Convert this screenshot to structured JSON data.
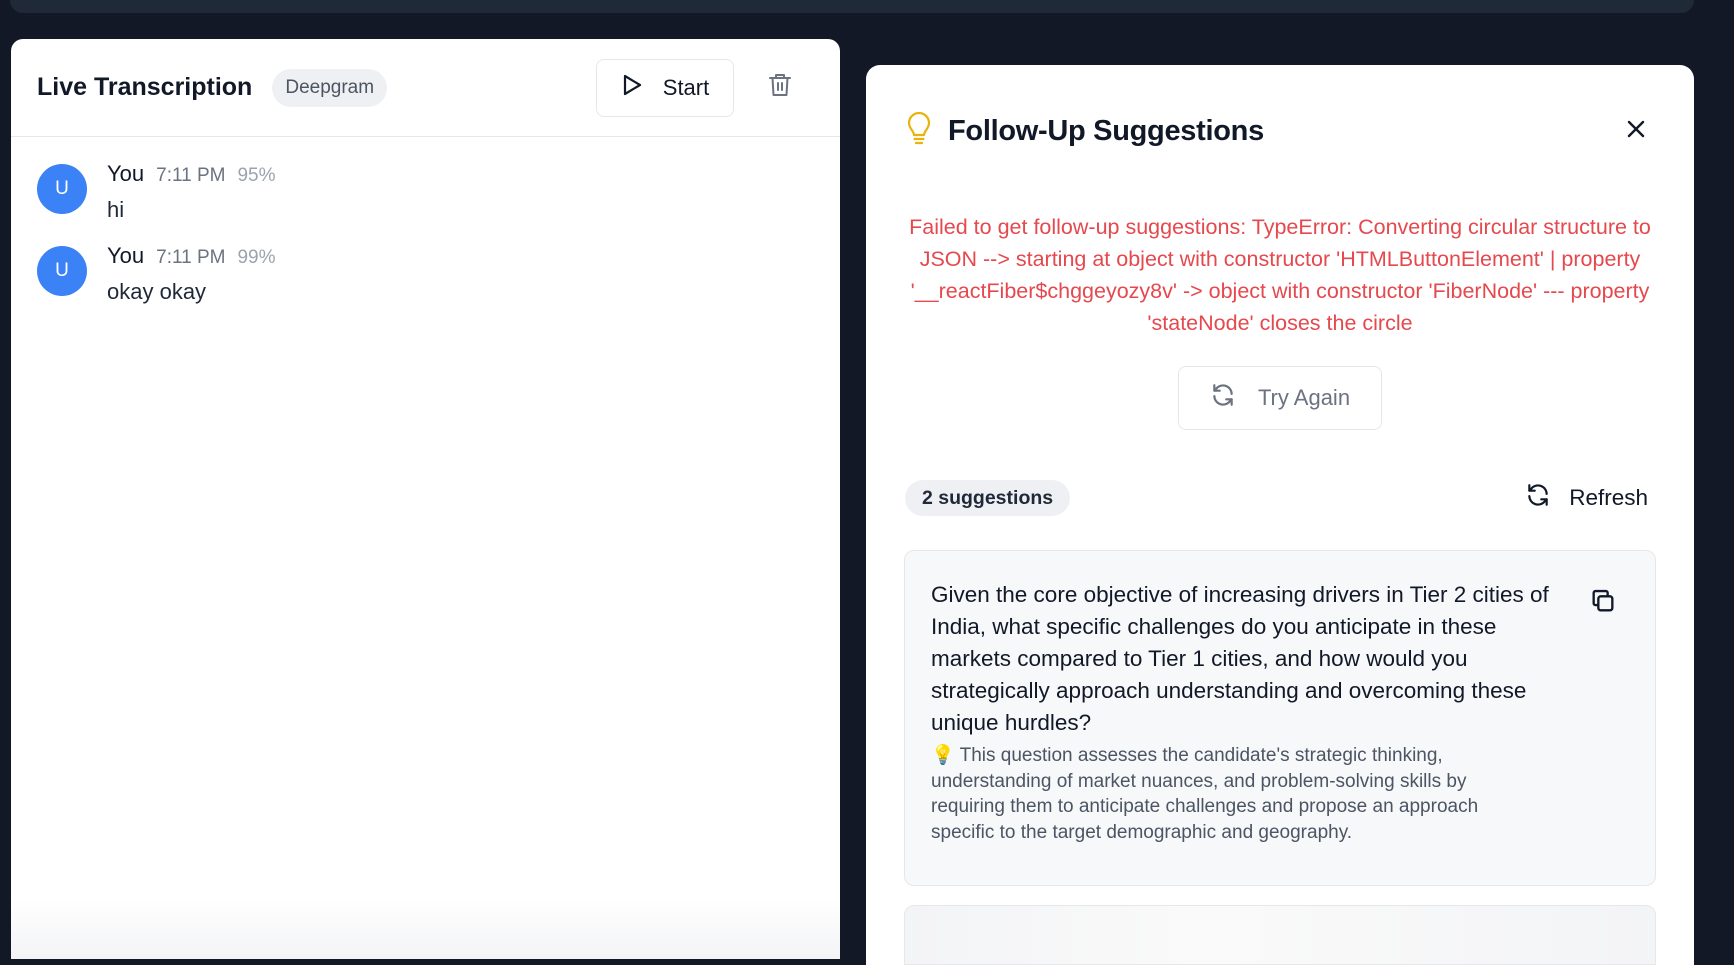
{
  "left_panel": {
    "title": "Live Transcription",
    "provider_badge": "Deepgram",
    "start_label": "Start",
    "messages": [
      {
        "avatar": "U",
        "author": "You",
        "time": "7:11 PM",
        "confidence": "95%",
        "text": "hi"
      },
      {
        "avatar": "U",
        "author": "You",
        "time": "7:11 PM",
        "confidence": "99%",
        "text": "okay okay"
      }
    ]
  },
  "right_panel": {
    "title": "Follow-Up Suggestions",
    "error": "Failed to get follow-up suggestions: TypeError: Converting circular structure to JSON --> starting at object with constructor 'HTMLButtonElement' | property '__reactFiber$chggeyozy8v' -> object with constructor 'FiberNode' --- property 'stateNode' closes the circle",
    "try_again_label": "Try Again",
    "count_label": "2 suggestions",
    "refresh_label": "Refresh",
    "suggestions": [
      {
        "question": "Given the core objective of increasing drivers in Tier 2 cities of India, what specific challenges do you anticipate in these markets compared to Tier 1 cities, and how would you strategically approach understanding and overcoming these unique hurdles?",
        "reason": "💡 This question assesses the candidate's strategic thinking, understanding of market nuances, and problem-solving skills by requiring them to anticipate challenges and propose an approach specific to the target demographic and geography."
      }
    ]
  },
  "icons": {
    "start": "play-icon",
    "clear": "trash-icon",
    "header": "lightbulb-icon",
    "close": "close-icon",
    "retry": "refresh-icon",
    "copy": "copy-icon"
  },
  "colors": {
    "background": "#121826",
    "avatar": "#3b82f6",
    "error": "#e5484d",
    "bulb": "#eab308"
  }
}
